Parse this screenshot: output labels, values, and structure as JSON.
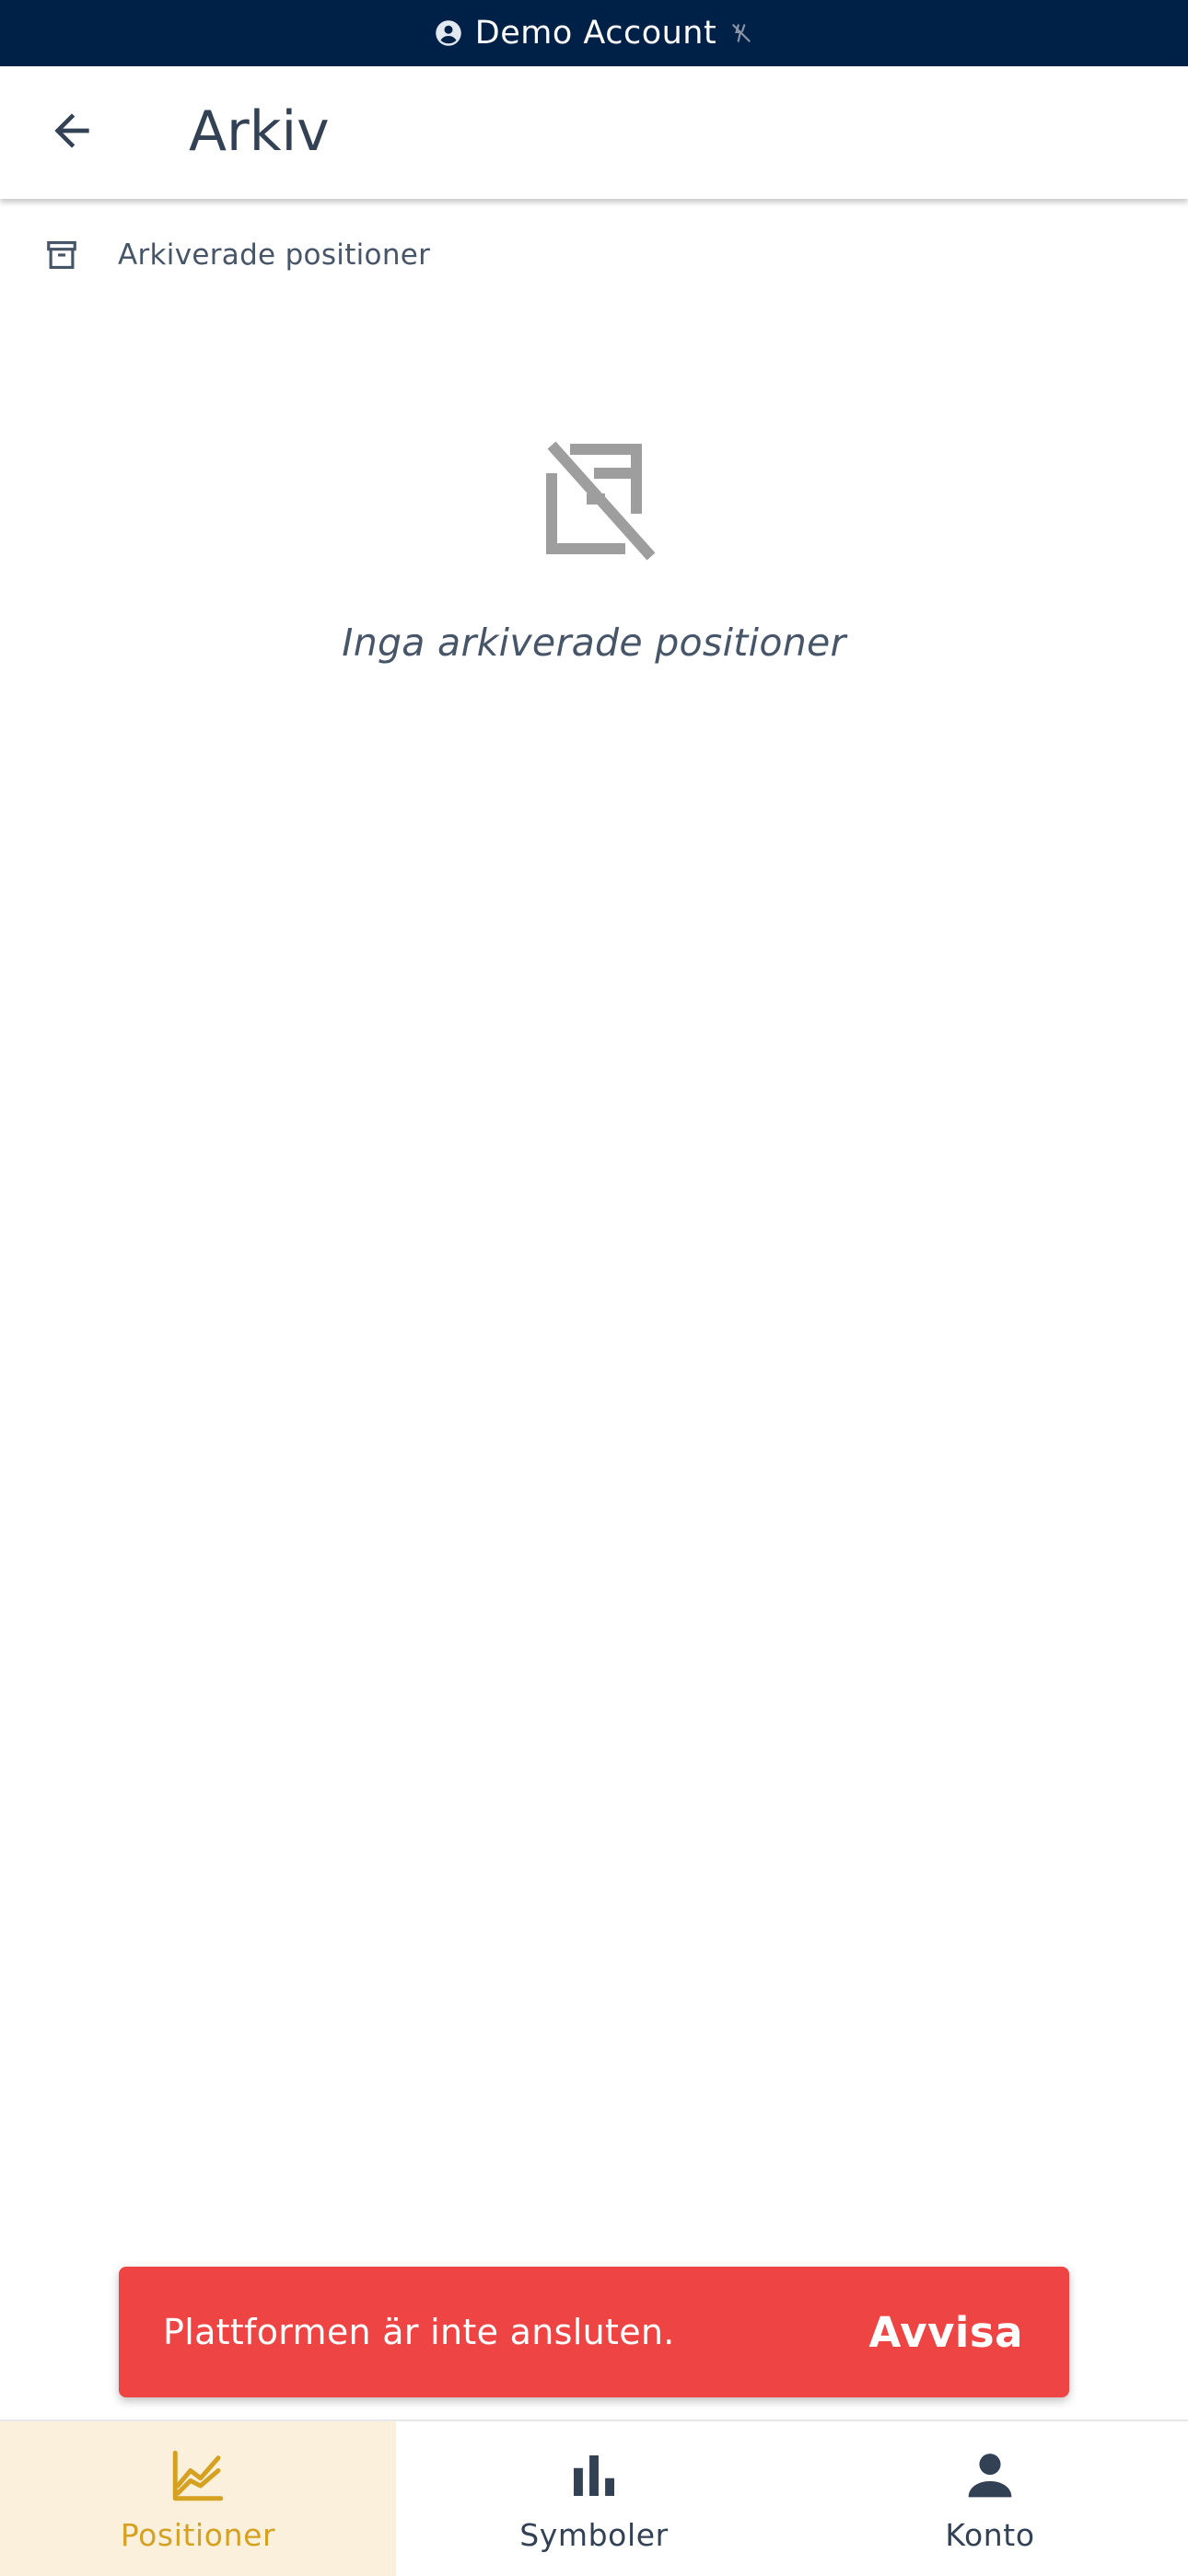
{
  "account_bar": {
    "label": "Demo Account",
    "icon_left": "account-circle-icon",
    "icon_right": "sync-disabled-icon"
  },
  "app_bar": {
    "back_icon": "arrow-back-icon",
    "title": "Arkiv"
  },
  "section": {
    "icon": "archive-icon",
    "label": "Arkiverade positioner"
  },
  "empty_state": {
    "icon": "archive-off-icon",
    "message": "Inga arkiverade positioner"
  },
  "snackbar": {
    "message": "Plattformen är inte ansluten.",
    "action": "Avvisa",
    "background": "#ef4444"
  },
  "bottom_nav": {
    "items": [
      {
        "label": "Positioner",
        "icon": "line-chart-icon",
        "active": true
      },
      {
        "label": "Symboler",
        "icon": "bar-chart-icon",
        "active": false
      },
      {
        "label": "Konto",
        "icon": "person-icon",
        "active": false
      }
    ]
  },
  "colors": {
    "banner": "#002147",
    "accent": "#d6a021",
    "accent_bg": "#faf0dc",
    "text": "#334155",
    "icon_gray": "#9e9e9e"
  }
}
